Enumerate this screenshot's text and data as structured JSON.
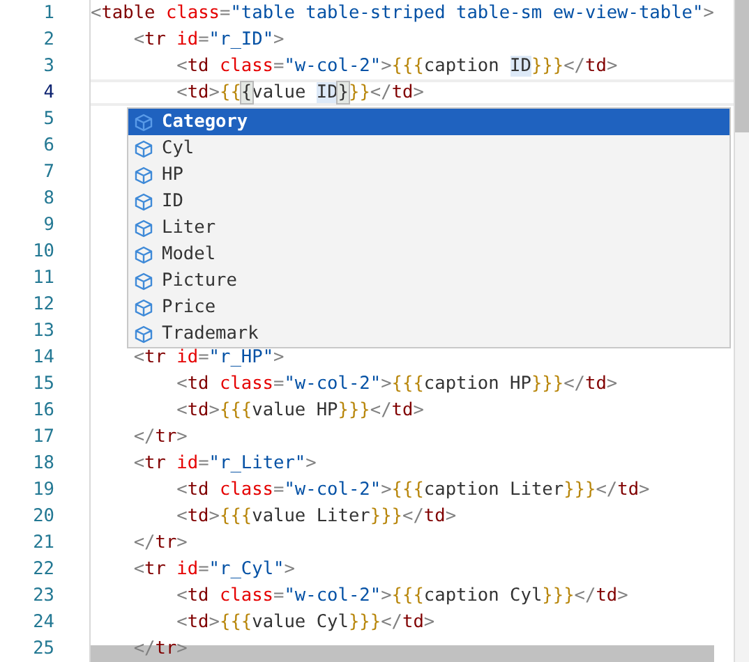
{
  "editor": {
    "lines": [
      {
        "number": "1",
        "current": false,
        "tokens": [
          {
            "kind": "punct",
            "text": "<"
          },
          {
            "kind": "tag",
            "text": "table "
          },
          {
            "kind": "attr",
            "text": "class"
          },
          {
            "kind": "punct",
            "text": "="
          },
          {
            "kind": "str",
            "text": "\"table table-striped table-sm ew-view-table\""
          },
          {
            "kind": "punct",
            "text": ">"
          }
        ]
      },
      {
        "number": "2",
        "current": false,
        "tokens": [
          {
            "kind": "punct",
            "text": "    <"
          },
          {
            "kind": "tag",
            "text": "tr "
          },
          {
            "kind": "attr",
            "text": "id"
          },
          {
            "kind": "punct",
            "text": "="
          },
          {
            "kind": "str",
            "text": "\"r_ID\""
          },
          {
            "kind": "punct",
            "text": ">"
          }
        ]
      },
      {
        "number": "3",
        "current": false,
        "tokens": [
          {
            "kind": "punct",
            "text": "        <"
          },
          {
            "kind": "tag",
            "text": "td "
          },
          {
            "kind": "attr",
            "text": "class"
          },
          {
            "kind": "punct",
            "text": "="
          },
          {
            "kind": "str",
            "text": "\"w-col-2\""
          },
          {
            "kind": "punct",
            "text": ">"
          },
          {
            "kind": "brace",
            "text": "{{{"
          },
          {
            "kind": "text",
            "text": "caption "
          },
          {
            "kind": "highlight",
            "text": "ID"
          },
          {
            "kind": "brace",
            "text": "}}}"
          },
          {
            "kind": "punct",
            "text": "</"
          },
          {
            "kind": "tag",
            "text": "td"
          },
          {
            "kind": "punct",
            "text": ">"
          }
        ]
      },
      {
        "number": "4",
        "current": true,
        "tokens": [
          {
            "kind": "punct",
            "text": "        <"
          },
          {
            "kind": "tag",
            "text": "td"
          },
          {
            "kind": "punct",
            "text": ">"
          },
          {
            "kind": "brace",
            "text": "{{"
          },
          {
            "kind": "match",
            "text": "{"
          },
          {
            "kind": "text",
            "text": "value "
          },
          {
            "kind": "highlight",
            "text": "ID"
          },
          {
            "kind": "match",
            "text": "}"
          },
          {
            "kind": "brace",
            "text": "}}"
          },
          {
            "kind": "punct",
            "text": "</"
          },
          {
            "kind": "tag",
            "text": "td"
          },
          {
            "kind": "punct",
            "text": ">"
          }
        ]
      },
      {
        "number": "5",
        "current": false
      },
      {
        "number": "6",
        "current": false
      },
      {
        "number": "7",
        "current": false
      },
      {
        "number": "8",
        "current": false
      },
      {
        "number": "9",
        "current": false
      },
      {
        "number": "10",
        "current": false
      },
      {
        "number": "11",
        "current": false
      },
      {
        "number": "12",
        "current": false
      },
      {
        "number": "13",
        "current": false
      },
      {
        "number": "14",
        "current": false,
        "tokens": [
          {
            "kind": "punct",
            "text": "    <"
          },
          {
            "kind": "tag",
            "text": "tr "
          },
          {
            "kind": "attr",
            "text": "id"
          },
          {
            "kind": "punct",
            "text": "="
          },
          {
            "kind": "str",
            "text": "\"r_HP\""
          },
          {
            "kind": "punct",
            "text": ">"
          }
        ]
      },
      {
        "number": "15",
        "current": false,
        "tokens": [
          {
            "kind": "punct",
            "text": "        <"
          },
          {
            "kind": "tag",
            "text": "td "
          },
          {
            "kind": "attr",
            "text": "class"
          },
          {
            "kind": "punct",
            "text": "="
          },
          {
            "kind": "str",
            "text": "\"w-col-2\""
          },
          {
            "kind": "punct",
            "text": ">"
          },
          {
            "kind": "brace",
            "text": "{{{"
          },
          {
            "kind": "text",
            "text": "caption HP"
          },
          {
            "kind": "brace",
            "text": "}}}"
          },
          {
            "kind": "punct",
            "text": "</"
          },
          {
            "kind": "tag",
            "text": "td"
          },
          {
            "kind": "punct",
            "text": ">"
          }
        ]
      },
      {
        "number": "16",
        "current": false,
        "tokens": [
          {
            "kind": "punct",
            "text": "        <"
          },
          {
            "kind": "tag",
            "text": "td"
          },
          {
            "kind": "punct",
            "text": ">"
          },
          {
            "kind": "brace",
            "text": "{{{"
          },
          {
            "kind": "text",
            "text": "value HP"
          },
          {
            "kind": "brace",
            "text": "}}}"
          },
          {
            "kind": "punct",
            "text": "</"
          },
          {
            "kind": "tag",
            "text": "td"
          },
          {
            "kind": "punct",
            "text": ">"
          }
        ]
      },
      {
        "number": "17",
        "current": false,
        "tokens": [
          {
            "kind": "punct",
            "text": "    </"
          },
          {
            "kind": "tag",
            "text": "tr"
          },
          {
            "kind": "punct",
            "text": ">"
          }
        ]
      },
      {
        "number": "18",
        "current": false,
        "tokens": [
          {
            "kind": "punct",
            "text": "    <"
          },
          {
            "kind": "tag",
            "text": "tr "
          },
          {
            "kind": "attr",
            "text": "id"
          },
          {
            "kind": "punct",
            "text": "="
          },
          {
            "kind": "str",
            "text": "\"r_Liter\""
          },
          {
            "kind": "punct",
            "text": ">"
          }
        ]
      },
      {
        "number": "19",
        "current": false,
        "tokens": [
          {
            "kind": "punct",
            "text": "        <"
          },
          {
            "kind": "tag",
            "text": "td "
          },
          {
            "kind": "attr",
            "text": "class"
          },
          {
            "kind": "punct",
            "text": "="
          },
          {
            "kind": "str",
            "text": "\"w-col-2\""
          },
          {
            "kind": "punct",
            "text": ">"
          },
          {
            "kind": "brace",
            "text": "{{{"
          },
          {
            "kind": "text",
            "text": "caption Liter"
          },
          {
            "kind": "brace",
            "text": "}}}"
          },
          {
            "kind": "punct",
            "text": "</"
          },
          {
            "kind": "tag",
            "text": "td"
          },
          {
            "kind": "punct",
            "text": ">"
          }
        ]
      },
      {
        "number": "20",
        "current": false,
        "tokens": [
          {
            "kind": "punct",
            "text": "        <"
          },
          {
            "kind": "tag",
            "text": "td"
          },
          {
            "kind": "punct",
            "text": ">"
          },
          {
            "kind": "brace",
            "text": "{{{"
          },
          {
            "kind": "text",
            "text": "value Liter"
          },
          {
            "kind": "brace",
            "text": "}}}"
          },
          {
            "kind": "punct",
            "text": "</"
          },
          {
            "kind": "tag",
            "text": "td"
          },
          {
            "kind": "punct",
            "text": ">"
          }
        ]
      },
      {
        "number": "21",
        "current": false,
        "tokens": [
          {
            "kind": "punct",
            "text": "    </"
          },
          {
            "kind": "tag",
            "text": "tr"
          },
          {
            "kind": "punct",
            "text": ">"
          }
        ]
      },
      {
        "number": "22",
        "current": false,
        "tokens": [
          {
            "kind": "punct",
            "text": "    <"
          },
          {
            "kind": "tag",
            "text": "tr "
          },
          {
            "kind": "attr",
            "text": "id"
          },
          {
            "kind": "punct",
            "text": "="
          },
          {
            "kind": "str",
            "text": "\"r_Cyl\""
          },
          {
            "kind": "punct",
            "text": ">"
          }
        ]
      },
      {
        "number": "23",
        "current": false,
        "tokens": [
          {
            "kind": "punct",
            "text": "        <"
          },
          {
            "kind": "tag",
            "text": "td "
          },
          {
            "kind": "attr",
            "text": "class"
          },
          {
            "kind": "punct",
            "text": "="
          },
          {
            "kind": "str",
            "text": "\"w-col-2\""
          },
          {
            "kind": "punct",
            "text": ">"
          },
          {
            "kind": "brace",
            "text": "{{{"
          },
          {
            "kind": "text",
            "text": "caption Cyl"
          },
          {
            "kind": "brace",
            "text": "}}}"
          },
          {
            "kind": "punct",
            "text": "</"
          },
          {
            "kind": "tag",
            "text": "td"
          },
          {
            "kind": "punct",
            "text": ">"
          }
        ]
      },
      {
        "number": "24",
        "current": false,
        "tokens": [
          {
            "kind": "punct",
            "text": "        <"
          },
          {
            "kind": "tag",
            "text": "td"
          },
          {
            "kind": "punct",
            "text": ">"
          },
          {
            "kind": "brace",
            "text": "{{{"
          },
          {
            "kind": "text",
            "text": "value Cyl"
          },
          {
            "kind": "brace",
            "text": "}}}"
          },
          {
            "kind": "punct",
            "text": "</"
          },
          {
            "kind": "tag",
            "text": "td"
          },
          {
            "kind": "punct",
            "text": ">"
          }
        ]
      },
      {
        "number": "25",
        "current": false,
        "tokens": [
          {
            "kind": "punct",
            "text": "    </"
          },
          {
            "kind": "tag",
            "text": "tr"
          },
          {
            "kind": "punct",
            "text": ">"
          }
        ]
      }
    ]
  },
  "suggestions": [
    {
      "label": "Category",
      "selected": true
    },
    {
      "label": "Cyl",
      "selected": false
    },
    {
      "label": "HP",
      "selected": false
    },
    {
      "label": "ID",
      "selected": false
    },
    {
      "label": "Liter",
      "selected": false
    },
    {
      "label": "Model",
      "selected": false
    },
    {
      "label": "Picture",
      "selected": false
    },
    {
      "label": "Price",
      "selected": false
    },
    {
      "label": "Trademark",
      "selected": false
    }
  ]
}
